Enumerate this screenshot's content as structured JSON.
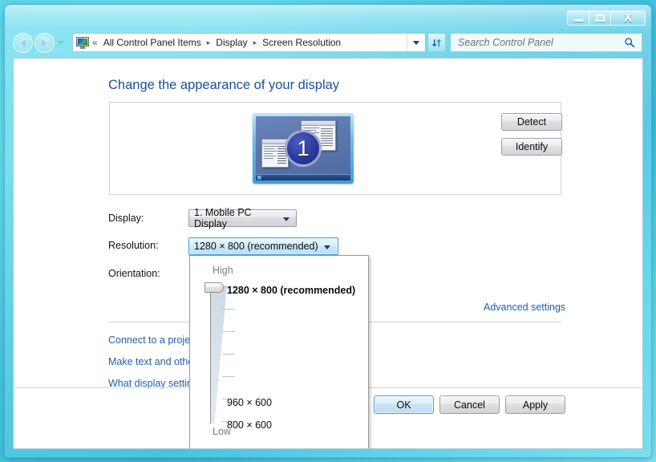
{
  "window": {
    "controls": {
      "minimize_label": "Minimize",
      "maximize_label": "Maximize",
      "close_label": "X"
    }
  },
  "navbar": {
    "back_label": "Back",
    "forward_label": "Forward",
    "history_label": "Recent pages",
    "address_icon": "display-monitor-icon",
    "overflow_chevron": "«",
    "breadcrumbs": [
      "All Control Panel Items",
      "Display",
      "Screen Resolution"
    ],
    "separator": "▸",
    "dropdown_label": "Previous locations",
    "refresh_label": "Refresh",
    "search": {
      "placeholder": "Search Control Panel",
      "value": "",
      "icon": "search-icon"
    }
  },
  "main": {
    "page_title": "Change the appearance of your display",
    "preview": {
      "monitor_number": "1",
      "detect_label": "Detect",
      "identify_label": "Identify"
    },
    "fields": {
      "display_label": "Display:",
      "display_value": "1. Mobile PC Display",
      "resolution_label": "Resolution:",
      "resolution_value": "1280 × 800 (recommended)",
      "orientation_label": "Orientation:"
    },
    "resolution_popup": {
      "high_label": "High",
      "low_label": "Low",
      "options": [
        {
          "label": "1280 × 800 (recommended)",
          "selected": true
        },
        {
          "label": "960 × 600",
          "selected": false
        },
        {
          "label": "800 × 600",
          "selected": false
        }
      ],
      "tick_count": 7
    },
    "links": {
      "advanced_settings": "Advanced settings",
      "connect_projector": "Connect to a projec",
      "make_text_larger": "Make text and other",
      "what_display_settings": "What display setting"
    },
    "buttons": {
      "ok": "OK",
      "cancel": "Cancel",
      "apply": "Apply"
    }
  },
  "colors": {
    "accent_blue": "#1c4f9c",
    "link_blue": "#1c5fb0",
    "focus_border": "#3c9cd6",
    "aero_glass": "#46c8e3"
  }
}
